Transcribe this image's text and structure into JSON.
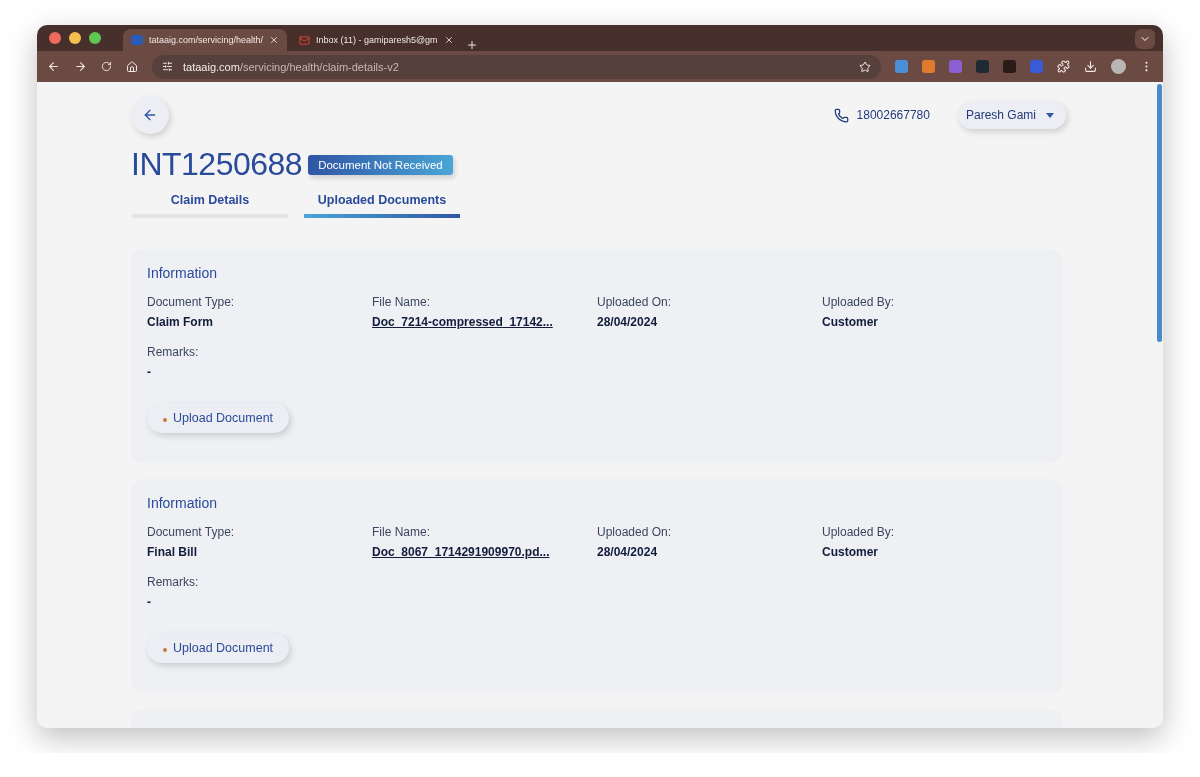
{
  "browser": {
    "tabs": [
      {
        "title": "tataaig.com/servicing/health/",
        "selected": true
      },
      {
        "title": "Inbox (11) - gamiparesh5@gm",
        "selected": false
      }
    ],
    "address": {
      "domain": "tataaig.com",
      "path": "/servicing/health/claim-details-v2"
    }
  },
  "header": {
    "phone": "18002667780",
    "user": "Paresh Gami"
  },
  "claim": {
    "id": "INT1250688",
    "status": "Document Not Received"
  },
  "tabs": [
    {
      "label": "Claim Details",
      "selected": false
    },
    {
      "label": "Uploaded Documents",
      "selected": true
    }
  ],
  "documents": [
    {
      "heading": "Information",
      "fields": [
        {
          "label": "Document Type:",
          "value": "Claim Form",
          "kind": "text"
        },
        {
          "label": "File Name:",
          "value": "Doc_7214-compressed_17142...",
          "kind": "link"
        },
        {
          "label": "Uploaded On:",
          "value": "28/04/2024",
          "kind": "text"
        },
        {
          "label": "Uploaded By:",
          "value": "Customer",
          "kind": "text"
        }
      ],
      "remarks_label": "Remarks:",
      "remarks": "-",
      "button": "Upload Document"
    },
    {
      "heading": "Information",
      "fields": [
        {
          "label": "Document Type:",
          "value": "Final Bill",
          "kind": "text"
        },
        {
          "label": "File Name:",
          "value": "Doc_8067_1714291909970.pd...",
          "kind": "link"
        },
        {
          "label": "Uploaded On:",
          "value": "28/04/2024",
          "kind": "text"
        },
        {
          "label": "Uploaded By:",
          "value": "Customer",
          "kind": "text"
        }
      ],
      "remarks_label": "Remarks:",
      "remarks": "-",
      "button": "Upload Document"
    }
  ]
}
